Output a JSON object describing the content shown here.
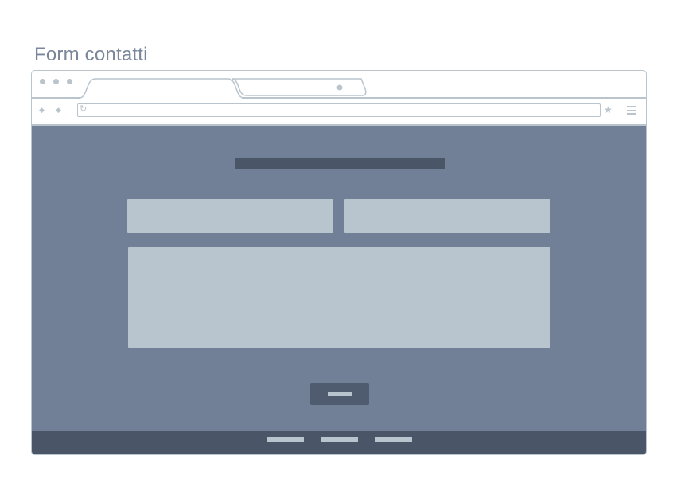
{
  "page": {
    "title": "Form contatti"
  },
  "browser": {
    "tabs": [
      {
        "label": "",
        "state": "active"
      },
      {
        "label": "",
        "state": "inactive"
      }
    ],
    "address_bar": {
      "value": "",
      "placeholder": ""
    },
    "icons": [
      "back-arrow-icon",
      "forward-arrow-icon",
      "reload-icon",
      "bookmark-star-icon",
      "menu-icon"
    ]
  },
  "wireframe": {
    "heading": "",
    "fields": [
      {
        "name": "first-field",
        "value": ""
      },
      {
        "name": "second-field",
        "value": ""
      },
      {
        "name": "message-field",
        "value": ""
      }
    ],
    "submit_label": "",
    "footer_links": [
      "",
      "",
      ""
    ]
  },
  "colors": {
    "outline": "#b9c4cd",
    "title_text": "#7a879a",
    "content_background": "#718096",
    "placeholder_block": "#b8c5cf",
    "dark_block": "#4a5568"
  }
}
